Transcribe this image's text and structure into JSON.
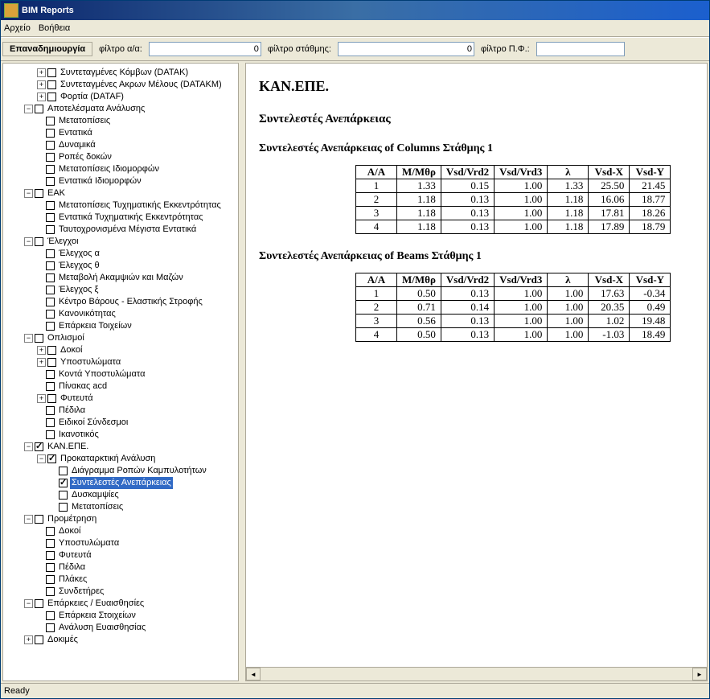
{
  "window": {
    "title": "BIM Reports"
  },
  "menu": {
    "file": "Αρχείο",
    "help": "Βοήθεια"
  },
  "toolbar": {
    "regen": "Επαναδημιουργία",
    "filter_aa_label": "φίλτρο α/α:",
    "filter_aa_value": "0",
    "filter_level_label": "φίλτρο στάθμης:",
    "filter_level_value": "0",
    "filter_pf_label": "φίλτρο Π.Φ.:",
    "filter_pf_value": ""
  },
  "tree": {
    "items": [
      {
        "d": 2,
        "exp": "+",
        "cb": false,
        "label": "Συντεταγμένες Κόμβων (DATAK)"
      },
      {
        "d": 2,
        "exp": "+",
        "cb": false,
        "label": "Συντεταγμένες Ακρων Μέλους (DATAKM)"
      },
      {
        "d": 2,
        "exp": "+",
        "cb": false,
        "label": "Φορτία (DATAF)"
      },
      {
        "d": 1,
        "exp": "-",
        "cb": false,
        "label": "Αποτελέσματα Ανάλυσης"
      },
      {
        "d": 2,
        "exp": "",
        "cb": false,
        "label": "Μετατοπίσεις"
      },
      {
        "d": 2,
        "exp": "",
        "cb": false,
        "label": "Εντατικά"
      },
      {
        "d": 2,
        "exp": "",
        "cb": false,
        "label": "Δυναμικά"
      },
      {
        "d": 2,
        "exp": "",
        "cb": false,
        "label": "Ροπές δοκών"
      },
      {
        "d": 2,
        "exp": "",
        "cb": false,
        "label": "Μετατοπίσεις Ιδιομορφών"
      },
      {
        "d": 2,
        "exp": "",
        "cb": false,
        "label": "Εντατικά Ιδιομορφών"
      },
      {
        "d": 1,
        "exp": "-",
        "cb": false,
        "label": "EAK"
      },
      {
        "d": 2,
        "exp": "",
        "cb": false,
        "label": "Μετατοπίσεις Τυχηματικής Εκκεντρότητας"
      },
      {
        "d": 2,
        "exp": "",
        "cb": false,
        "label": "Εντατικά Τυχηματικής Εκκεντρότητας"
      },
      {
        "d": 2,
        "exp": "",
        "cb": false,
        "label": "Ταυτοχρονισμένα Μέγιστα Εντατικά"
      },
      {
        "d": 1,
        "exp": "-",
        "cb": false,
        "label": "Έλεγχοι"
      },
      {
        "d": 2,
        "exp": "",
        "cb": false,
        "label": "Έλεγχος α"
      },
      {
        "d": 2,
        "exp": "",
        "cb": false,
        "label": "Έλεγχος θ"
      },
      {
        "d": 2,
        "exp": "",
        "cb": false,
        "label": "Μεταβολή Ακαμψιών και Μαζών"
      },
      {
        "d": 2,
        "exp": "",
        "cb": false,
        "label": "Έλεγχος ξ"
      },
      {
        "d": 2,
        "exp": "",
        "cb": false,
        "label": "Κέντρο Βάρους - Ελαστικής Στροφής"
      },
      {
        "d": 2,
        "exp": "",
        "cb": false,
        "label": "Κανονικότητας"
      },
      {
        "d": 2,
        "exp": "",
        "cb": false,
        "label": "Επάρκεια Τοιχείων"
      },
      {
        "d": 1,
        "exp": "-",
        "cb": false,
        "label": "Οπλισμοί"
      },
      {
        "d": 2,
        "exp": "+",
        "cb": false,
        "label": "Δοκοί"
      },
      {
        "d": 2,
        "exp": "+",
        "cb": false,
        "label": "Υποστυλώματα"
      },
      {
        "d": 2,
        "exp": "",
        "cb": false,
        "label": "Κοντά Υποστυλώματα"
      },
      {
        "d": 2,
        "exp": "",
        "cb": false,
        "label": "Πίνακας acd"
      },
      {
        "d": 2,
        "exp": "+",
        "cb": false,
        "label": "Φυτευτά"
      },
      {
        "d": 2,
        "exp": "",
        "cb": false,
        "label": "Πέδιλα"
      },
      {
        "d": 2,
        "exp": "",
        "cb": false,
        "label": "Ειδικοί Σύνδεσμοι"
      },
      {
        "d": 2,
        "exp": "",
        "cb": false,
        "label": "Ικανοτικός"
      },
      {
        "d": 1,
        "exp": "-",
        "cb": true,
        "label": "ΚΑΝ.ΕΠΕ."
      },
      {
        "d": 2,
        "exp": "-",
        "cb": true,
        "label": "Προκαταρκτική Ανάλυση"
      },
      {
        "d": 3,
        "exp": "",
        "cb": false,
        "label": "Διάγραμμα Ροπών Καμπυλοτήτων"
      },
      {
        "d": 3,
        "exp": "",
        "cb": true,
        "label": "Συντελεστές Ανεπάρκειας",
        "sel": true
      },
      {
        "d": 3,
        "exp": "",
        "cb": false,
        "label": "Δυσκαμψίες"
      },
      {
        "d": 3,
        "exp": "",
        "cb": false,
        "label": "Μετατοπίσεις"
      },
      {
        "d": 1,
        "exp": "-",
        "cb": false,
        "label": "Προμέτρηση"
      },
      {
        "d": 2,
        "exp": "",
        "cb": false,
        "label": "Δοκοί"
      },
      {
        "d": 2,
        "exp": "",
        "cb": false,
        "label": "Υποστυλώματα"
      },
      {
        "d": 2,
        "exp": "",
        "cb": false,
        "label": "Φυτευτά"
      },
      {
        "d": 2,
        "exp": "",
        "cb": false,
        "label": "Πέδιλα"
      },
      {
        "d": 2,
        "exp": "",
        "cb": false,
        "label": "Πλάκες"
      },
      {
        "d": 2,
        "exp": "",
        "cb": false,
        "label": "Συνδετήρες"
      },
      {
        "d": 1,
        "exp": "-",
        "cb": false,
        "label": "Επάρκειες / Ευαισθησίες"
      },
      {
        "d": 2,
        "exp": "",
        "cb": false,
        "label": "Επάρκεια Στοιχείων"
      },
      {
        "d": 2,
        "exp": "",
        "cb": false,
        "label": "Ανάλυση Ευαισθησίας"
      },
      {
        "d": 1,
        "exp": "+",
        "cb": false,
        "label": "Δοκιμές"
      }
    ]
  },
  "content": {
    "title": "ΚΑΝ.ΕΠΕ.",
    "subtitle": "Συντελεστές Ανεπάρκειας",
    "tables": [
      {
        "caption": "Συντελεστές Ανεπάρκειας of Columns Στάθμης 1",
        "headers": [
          "A/A",
          "M/Mθρ",
          "Vsd/Vrd2",
          "Vsd/Vrd3",
          "λ",
          "Vsd-X",
          "Vsd-Y"
        ],
        "rows": [
          [
            "1",
            "1.33",
            "0.15",
            "1.00",
            "1.33",
            "25.50",
            "21.45"
          ],
          [
            "2",
            "1.18",
            "0.13",
            "1.00",
            "1.18",
            "16.06",
            "18.77"
          ],
          [
            "3",
            "1.18",
            "0.13",
            "1.00",
            "1.18",
            "17.81",
            "18.26"
          ],
          [
            "4",
            "1.18",
            "0.13",
            "1.00",
            "1.18",
            "17.89",
            "18.79"
          ]
        ]
      },
      {
        "caption": "Συντελεστές Ανεπάρκειας of Beams Στάθμης 1",
        "headers": [
          "A/A",
          "M/Mθρ",
          "Vsd/Vrd2",
          "Vsd/Vrd3",
          "λ",
          "Vsd-X",
          "Vsd-Y"
        ],
        "rows": [
          [
            "1",
            "0.50",
            "0.13",
            "1.00",
            "1.00",
            "17.63",
            "-0.34"
          ],
          [
            "2",
            "0.71",
            "0.14",
            "1.00",
            "1.00",
            "20.35",
            "0.49"
          ],
          [
            "3",
            "0.56",
            "0.13",
            "1.00",
            "1.00",
            "1.02",
            "19.48"
          ],
          [
            "4",
            "0.50",
            "0.13",
            "1.00",
            "1.00",
            "-1.03",
            "18.49"
          ]
        ]
      }
    ]
  },
  "status": {
    "text": "Ready"
  },
  "chart_data": {
    "type": "table",
    "tables": [
      {
        "title": "Συντελεστές Ανεπάρκειας of Columns Στάθμης 1",
        "columns": [
          "A/A",
          "M/Mθρ",
          "Vsd/Vrd2",
          "Vsd/Vrd3",
          "λ",
          "Vsd-X",
          "Vsd-Y"
        ],
        "data": [
          [
            1,
            1.33,
            0.15,
            1.0,
            1.33,
            25.5,
            21.45
          ],
          [
            2,
            1.18,
            0.13,
            1.0,
            1.18,
            16.06,
            18.77
          ],
          [
            3,
            1.18,
            0.13,
            1.0,
            1.18,
            17.81,
            18.26
          ],
          [
            4,
            1.18,
            0.13,
            1.0,
            1.18,
            17.89,
            18.79
          ]
        ]
      },
      {
        "title": "Συντελεστές Ανεπάρκειας of Beams Στάθμης 1",
        "columns": [
          "A/A",
          "M/Mθρ",
          "Vsd/Vrd2",
          "Vsd/Vrd3",
          "λ",
          "Vsd-X",
          "Vsd-Y"
        ],
        "data": [
          [
            1,
            0.5,
            0.13,
            1.0,
            1.0,
            17.63,
            -0.34
          ],
          [
            2,
            0.71,
            0.14,
            1.0,
            1.0,
            20.35,
            0.49
          ],
          [
            3,
            0.56,
            0.13,
            1.0,
            1.0,
            1.02,
            19.48
          ],
          [
            4,
            0.5,
            0.13,
            1.0,
            1.0,
            -1.03,
            18.49
          ]
        ]
      }
    ]
  }
}
